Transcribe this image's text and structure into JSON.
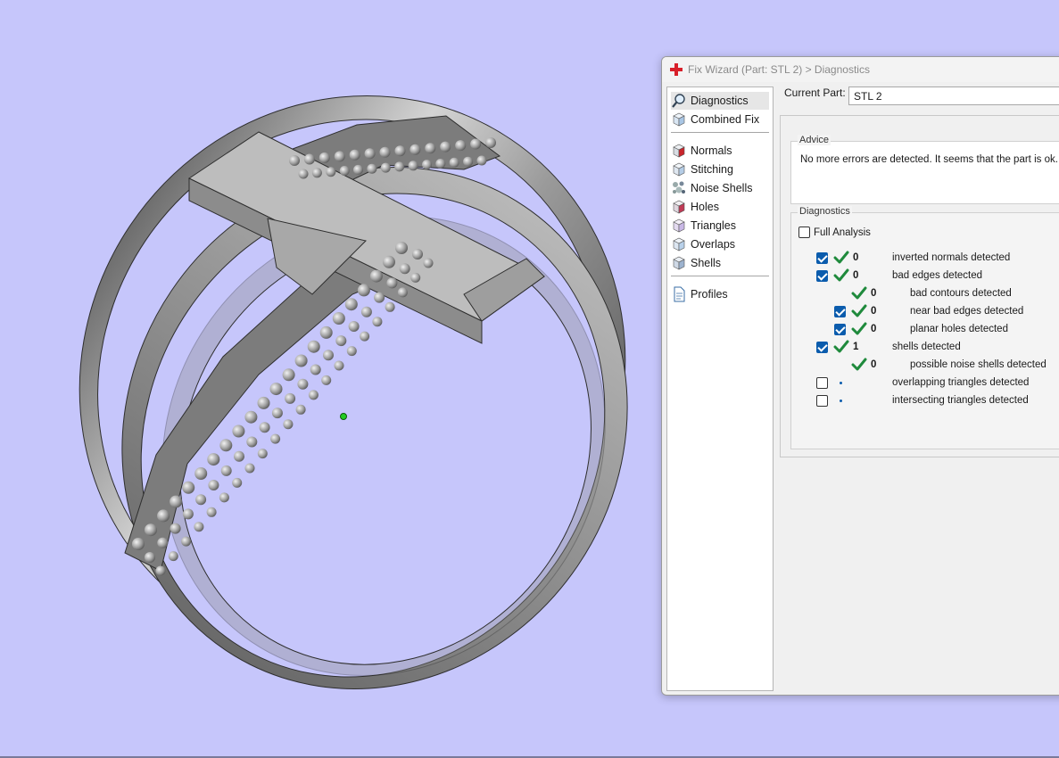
{
  "window": {
    "title": "Fix Wizard (Part: STL 2) > Diagnostics"
  },
  "nav": {
    "group1": [
      {
        "label": "Diagnostics",
        "icon": "magnifier-icon",
        "selected": true
      },
      {
        "label": "Combined Fix",
        "icon": "cube-icon"
      }
    ],
    "group2": [
      {
        "label": "Normals",
        "icon": "normals-cube-icon"
      },
      {
        "label": "Stitching",
        "icon": "stitching-cube-icon"
      },
      {
        "label": "Noise Shells",
        "icon": "noise-shells-icon"
      },
      {
        "label": "Holes",
        "icon": "holes-cube-icon"
      },
      {
        "label": "Triangles",
        "icon": "triangles-cube-icon"
      },
      {
        "label": "Overlaps",
        "icon": "overlaps-cube-icon"
      },
      {
        "label": "Shells",
        "icon": "shells-cube-icon"
      }
    ],
    "group3": [
      {
        "label": "Profiles",
        "icon": "document-icon"
      }
    ]
  },
  "current_part": {
    "label": "Current Part:",
    "value": "STL 2"
  },
  "advice": {
    "title": "Advice",
    "text": "No more errors are detected. It seems that the part is ok. No"
  },
  "diagnostics": {
    "title": "Diagnostics",
    "full_analysis_label": "Full Analysis",
    "full_analysis_checked": false,
    "rows": [
      {
        "checkbox": "checked",
        "status": "ok",
        "count": "0",
        "label": "inverted normals detected",
        "indent": 0
      },
      {
        "checkbox": "checked",
        "status": "ok",
        "count": "0",
        "label": "bad edges detected",
        "indent": 0
      },
      {
        "checkbox": "none",
        "status": "ok",
        "count": "0",
        "label": "bad contours detected",
        "indent": 1
      },
      {
        "checkbox": "checked",
        "status": "ok",
        "count": "0",
        "label": "near bad edges detected",
        "indent": 1
      },
      {
        "checkbox": "checked",
        "status": "ok",
        "count": "0",
        "label": "planar holes detected",
        "indent": 1
      },
      {
        "checkbox": "checked",
        "status": "ok",
        "count": "1",
        "label": "shells detected",
        "indent": 0
      },
      {
        "checkbox": "none",
        "status": "ok",
        "count": "0",
        "label": "possible noise shells detected",
        "indent": 1
      },
      {
        "checkbox": "unchecked",
        "status": "pending",
        "count": "",
        "label": "overlapping triangles detected",
        "indent": 0
      },
      {
        "checkbox": "unchecked",
        "status": "pending",
        "count": "",
        "label": "intersecting triangles detected",
        "indent": 0
      }
    ]
  },
  "colors": {
    "viewport_bg": "#c6c6fb",
    "check_green": "#1f8a3c",
    "checkbox_blue": "#0b5cad"
  }
}
